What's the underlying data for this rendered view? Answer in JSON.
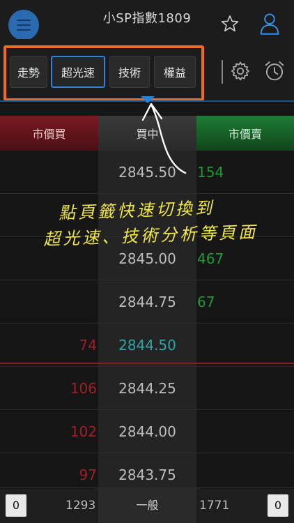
{
  "header": {
    "title": "小SP指數1809"
  },
  "tabs": [
    {
      "label": "走勢",
      "active": false
    },
    {
      "label": "超光速",
      "active": true
    },
    {
      "label": "技術",
      "active": false
    },
    {
      "label": "權益",
      "active": false
    }
  ],
  "columns": {
    "buy": "市價買",
    "price": "買中",
    "sell": "市價賣"
  },
  "rows": [
    {
      "buy": "",
      "price": "2845.50",
      "sell": "154",
      "current": false
    },
    {
      "buy": "",
      "price": "",
      "sell": "",
      "current": false
    },
    {
      "buy": "",
      "price": "2845.00",
      "sell": "467",
      "current": false
    },
    {
      "buy": "",
      "price": "2844.75",
      "sell": "67",
      "current": false
    },
    {
      "buy": "74",
      "price": "2844.50",
      "sell": "",
      "current": true
    },
    {
      "buy": "106",
      "price": "2844.25",
      "sell": "",
      "current": false
    },
    {
      "buy": "102",
      "price": "2844.00",
      "sell": "",
      "current": false
    },
    {
      "buy": "97",
      "price": "2843.75",
      "sell": "",
      "current": false
    }
  ],
  "footer": {
    "left_box": "0",
    "left_total": "1293",
    "mode": "一般",
    "right_total": "1771",
    "right_box": "0"
  },
  "annotation": {
    "line1": "點頁籤快速切換到",
    "line2": "超光速、技術分析等頁面"
  },
  "colors": {
    "accent": "#2e83d9",
    "highlight_frame": "#f06a1f",
    "buy": "#a01f28",
    "sell": "#1e9a35",
    "current_price": "#2ea6a6",
    "annotation": "#f0e64a"
  },
  "icons": [
    "menu-icon",
    "star-icon",
    "user-icon",
    "gear-icon",
    "alarm-clock-icon"
  ]
}
